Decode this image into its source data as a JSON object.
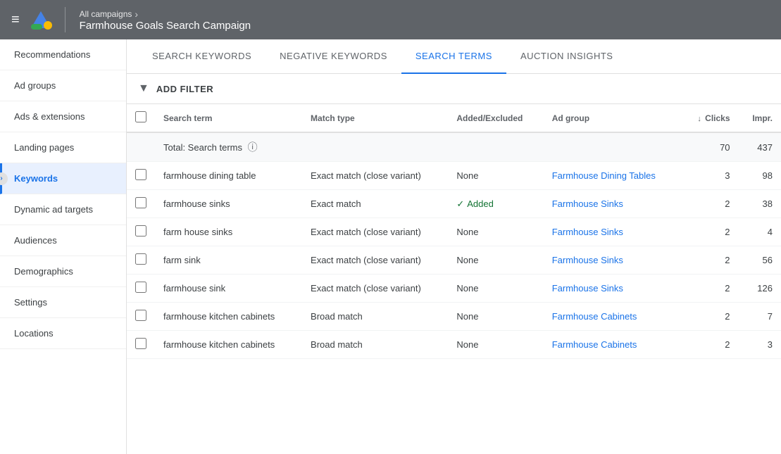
{
  "topbar": {
    "menu_icon": "≡",
    "campaign_path": "All campaigns",
    "campaign_name": "Farmhouse Goals Search Campaign",
    "chevron": "›"
  },
  "sidebar": {
    "items": [
      {
        "id": "recommendations",
        "label": "Recommendations",
        "active": false
      },
      {
        "id": "ad-groups",
        "label": "Ad groups",
        "active": false
      },
      {
        "id": "ads-extensions",
        "label": "Ads & extensions",
        "active": false
      },
      {
        "id": "landing-pages",
        "label": "Landing pages",
        "active": false
      },
      {
        "id": "keywords",
        "label": "Keywords",
        "active": true
      },
      {
        "id": "dynamic-ad-targets",
        "label": "Dynamic ad targets",
        "active": false
      },
      {
        "id": "audiences",
        "label": "Audiences",
        "active": false
      },
      {
        "id": "demographics",
        "label": "Demographics",
        "active": false
      },
      {
        "id": "settings",
        "label": "Settings",
        "active": false
      },
      {
        "id": "locations",
        "label": "Locations",
        "active": false
      }
    ],
    "arrow_icon": "›"
  },
  "tabs": [
    {
      "id": "search-keywords",
      "label": "Search Keywords",
      "active": false
    },
    {
      "id": "negative-keywords",
      "label": "Negative Keywords",
      "active": false
    },
    {
      "id": "search-terms",
      "label": "Search Terms",
      "active": true
    },
    {
      "id": "auction-insights",
      "label": "Auction Insights",
      "active": false
    }
  ],
  "filter_bar": {
    "icon": "▼",
    "label": "ADD FILTER"
  },
  "table": {
    "columns": [
      {
        "id": "checkbox",
        "label": ""
      },
      {
        "id": "search-term",
        "label": "Search term",
        "sortable": false
      },
      {
        "id": "match-type",
        "label": "Match type",
        "sortable": false
      },
      {
        "id": "added-excluded",
        "label": "Added/Excluded",
        "sortable": false
      },
      {
        "id": "ad-group",
        "label": "Ad group",
        "sortable": false
      },
      {
        "id": "clicks",
        "label": "Clicks",
        "sortable": true,
        "sort_icon": "↓"
      },
      {
        "id": "impr",
        "label": "Impr.",
        "sortable": false
      }
    ],
    "total_row": {
      "label": "Total: Search terms",
      "clicks": "70",
      "impr": "437"
    },
    "rows": [
      {
        "search_term": "farmhouse dining table",
        "match_type": "Exact match (close variant)",
        "added_excluded": "None",
        "ad_group": "Farmhouse Dining Tables",
        "clicks": "3",
        "impr": "98"
      },
      {
        "search_term": "farmhouse sinks",
        "match_type": "Exact match",
        "added_excluded": "Added",
        "ad_group": "Farmhouse Sinks",
        "clicks": "2",
        "impr": "38"
      },
      {
        "search_term": "farm house sinks",
        "match_type": "Exact match (close variant)",
        "added_excluded": "None",
        "ad_group": "Farmhouse Sinks",
        "clicks": "2",
        "impr": "4"
      },
      {
        "search_term": "farm sink",
        "match_type": "Exact match (close variant)",
        "added_excluded": "None",
        "ad_group": "Farmhouse Sinks",
        "clicks": "2",
        "impr": "56"
      },
      {
        "search_term": "farmhouse sink",
        "match_type": "Exact match (close variant)",
        "added_excluded": "None",
        "ad_group": "Farmhouse Sinks",
        "clicks": "2",
        "impr": "126"
      },
      {
        "search_term": "farmhouse kitchen cabinets",
        "match_type": "Broad match",
        "added_excluded": "None",
        "ad_group": "Farmhouse Cabinets",
        "clicks": "2",
        "impr": "7"
      },
      {
        "search_term": "farmhouse kitchen cabinets",
        "match_type": "Broad match",
        "added_excluded": "None",
        "ad_group": "Farmhouse Cabinets",
        "clicks": "2",
        "impr": "3"
      }
    ]
  }
}
